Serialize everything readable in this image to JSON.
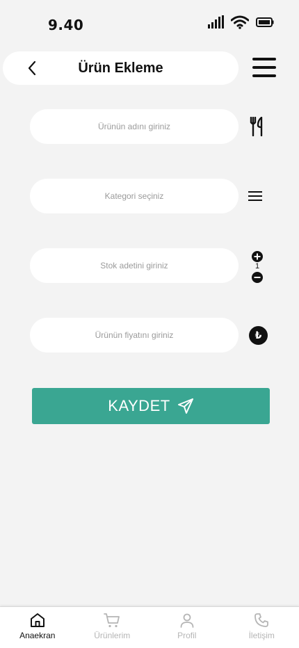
{
  "status_bar": {
    "time": "9.40"
  },
  "header": {
    "title": "Ürün Ekleme"
  },
  "form": {
    "product_name_placeholder": "Ürünün adını giriniz",
    "category_placeholder": "Kategori seçiniz",
    "stock_placeholder": "Stok adetini giriniz",
    "stock_value": "1",
    "price_placeholder": "Ürünün fiyatını giriniz",
    "currency_symbol": "₺"
  },
  "save_button": {
    "label": "KAYDET"
  },
  "bottom_nav": {
    "items": [
      {
        "label": "Anaekran",
        "icon": "home-icon",
        "active": true
      },
      {
        "label": "Ürünlerim",
        "icon": "cart-icon",
        "active": false
      },
      {
        "label": "Profil",
        "icon": "user-icon",
        "active": false
      },
      {
        "label": "İletişim",
        "icon": "phone-icon",
        "active": false
      }
    ]
  },
  "colors": {
    "accent": "#3aa692",
    "background": "#f3f3f3",
    "inactive": "#b5b5b5"
  }
}
